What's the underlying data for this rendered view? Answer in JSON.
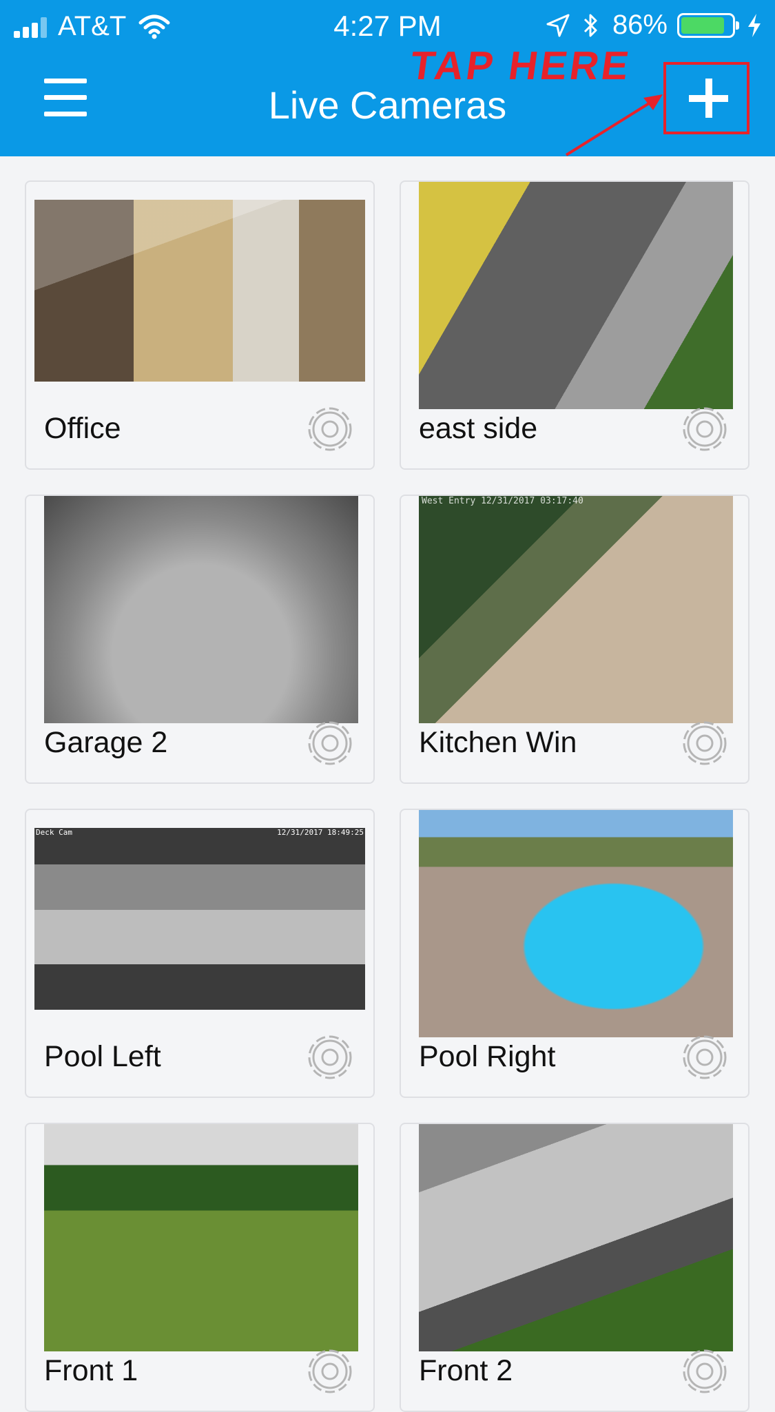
{
  "status_bar": {
    "carrier": "AT&T",
    "time": "4:27 PM",
    "battery_percent": "86%",
    "battery_level": 0.86,
    "icons": [
      "signal-icon",
      "wifi-icon",
      "location-icon",
      "bluetooth-icon",
      "battery-icon",
      "charging-icon"
    ]
  },
  "header": {
    "title": "Live Cameras",
    "menu_icon": "hamburger-menu-icon",
    "add_icon": "plus-icon",
    "annotation": "TAP HERE",
    "annotation_color": "#e8222a",
    "background": "#0a99e6"
  },
  "cameras": [
    {
      "label": "Office"
    },
    {
      "label": "east side"
    },
    {
      "label": "Garage 2"
    },
    {
      "label": "Kitchen Win"
    },
    {
      "label": "Pool Left"
    },
    {
      "label": "Pool Right"
    },
    {
      "label": "Front 1"
    },
    {
      "label": "Front 2"
    }
  ],
  "thumbnail_overlays": {
    "kitchen": "West Entry  12/31/2017 03:17:40",
    "pool_left_name": "Deck Cam",
    "pool_left_stamp": "12/31/2017 18:49:25"
  }
}
